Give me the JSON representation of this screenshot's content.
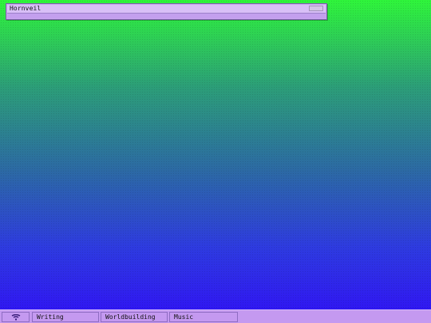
{
  "window": {
    "title": "Hornveil"
  },
  "taskbar": {
    "start_icon": "wifi-signal-icon",
    "items": [
      {
        "label": "Writing"
      },
      {
        "label": "Worldbuilding"
      },
      {
        "label": "Music"
      }
    ]
  },
  "colors": {
    "gradient_top": "#2ff53b",
    "gradient_bottom": "#3018f2",
    "chrome": "#c499f0"
  }
}
